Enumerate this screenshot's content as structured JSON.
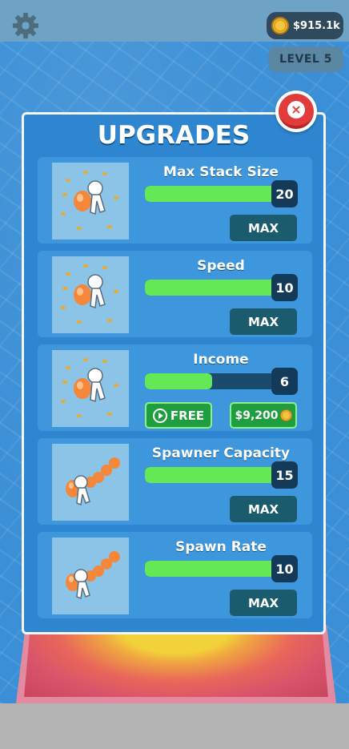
{
  "hud": {
    "money": "$915.1k",
    "level": "LEVEL 5"
  },
  "panel": {
    "title": "UPGRADES"
  },
  "upgrades": [
    {
      "name": "Max Stack Size",
      "level": "20",
      "progress": 1.0,
      "button": "MAX"
    },
    {
      "name": "Speed",
      "level": "10",
      "progress": 1.0,
      "button": "MAX"
    },
    {
      "name": "Income",
      "level": "6",
      "progress": 0.5,
      "free_label": "FREE",
      "price": "$9,200"
    },
    {
      "name": "Spawner Capacity",
      "level": "15",
      "progress": 1.0,
      "button": "MAX"
    },
    {
      "name": "Spawn Rate",
      "level": "10",
      "progress": 1.0,
      "button": "MAX"
    }
  ],
  "colors": {
    "panel": "#2f86d0",
    "card": "#3e96dc",
    "progress_fill": "#64e855",
    "max_button": "#1b5b6e",
    "buy_button": "#1e9e3e",
    "close_button": "#e23b3b"
  },
  "icons": {
    "settings": "gear-icon",
    "currency": "coin-icon",
    "close": "close-icon",
    "free_video": "play-icon"
  }
}
